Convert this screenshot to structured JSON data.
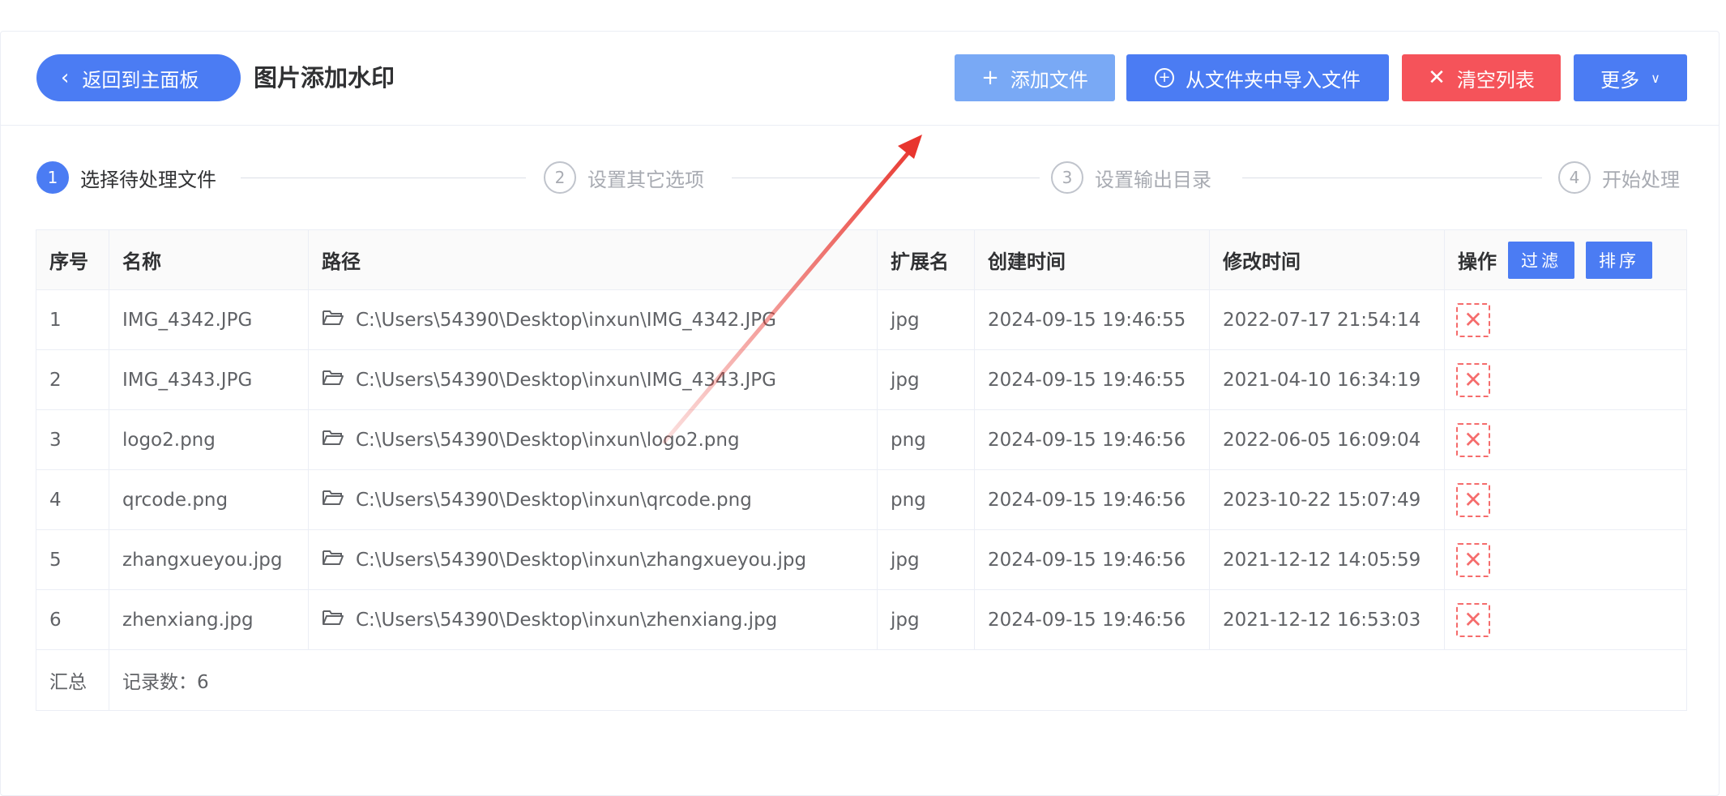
{
  "header": {
    "back_label": "返回到主面板",
    "title": "图片添加水印",
    "buttons": {
      "add_file": "添加文件",
      "import_folder": "从文件夹中导入文件",
      "clear_list": "清空列表",
      "more": "更多"
    }
  },
  "steps": [
    {
      "num": "1",
      "label": "选择待处理文件",
      "active": true
    },
    {
      "num": "2",
      "label": "设置其它选项",
      "active": false
    },
    {
      "num": "3",
      "label": "设置输出目录",
      "active": false
    },
    {
      "num": "4",
      "label": "开始处理",
      "active": false
    }
  ],
  "table": {
    "columns": [
      "序号",
      "名称",
      "路径",
      "扩展名",
      "创建时间",
      "修改时间",
      "操作"
    ],
    "filter_label": "过滤",
    "sort_label": "排序",
    "rows": [
      {
        "idx": "1",
        "name": "IMG_4342.JPG",
        "path": "C:\\Users\\54390\\Desktop\\inxun\\IMG_4342.JPG",
        "ext": "jpg",
        "created": "2024-09-15 19:46:55",
        "modified": "2022-07-17 21:54:14"
      },
      {
        "idx": "2",
        "name": "IMG_4343.JPG",
        "path": "C:\\Users\\54390\\Desktop\\inxun\\IMG_4343.JPG",
        "ext": "jpg",
        "created": "2024-09-15 19:46:55",
        "modified": "2021-04-10 16:34:19"
      },
      {
        "idx": "3",
        "name": "logo2.png",
        "path": "C:\\Users\\54390\\Desktop\\inxun\\logo2.png",
        "ext": "png",
        "created": "2024-09-15 19:46:56",
        "modified": "2022-06-05 16:09:04"
      },
      {
        "idx": "4",
        "name": "qrcode.png",
        "path": "C:\\Users\\54390\\Desktop\\inxun\\qrcode.png",
        "ext": "png",
        "created": "2024-09-15 19:46:56",
        "modified": "2023-10-22 15:07:49"
      },
      {
        "idx": "5",
        "name": "zhangxueyou.jpg",
        "path": "C:\\Users\\54390\\Desktop\\inxun\\zhangxueyou.jpg",
        "ext": "jpg",
        "created": "2024-09-15 19:46:56",
        "modified": "2021-12-12 14:05:59"
      },
      {
        "idx": "6",
        "name": "zhenxiang.jpg",
        "path": "C:\\Users\\54390\\Desktop\\inxun\\zhenxiang.jpg",
        "ext": "jpg",
        "created": "2024-09-15 19:46:56",
        "modified": "2021-12-12 16:53:03"
      }
    ],
    "summary_label": "汇总",
    "record_count_text": "记录数：6"
  },
  "colors": {
    "primary": "#4b7cf3",
    "primary_light": "#79a9f5",
    "danger": "#f5535a",
    "annotation_arrow": "#e8352e"
  },
  "icons": [
    "chevron-left-icon",
    "plus-icon",
    "circle-plus-icon",
    "close-icon",
    "chevron-down-icon",
    "folder-open-icon",
    "delete-x-icon"
  ]
}
